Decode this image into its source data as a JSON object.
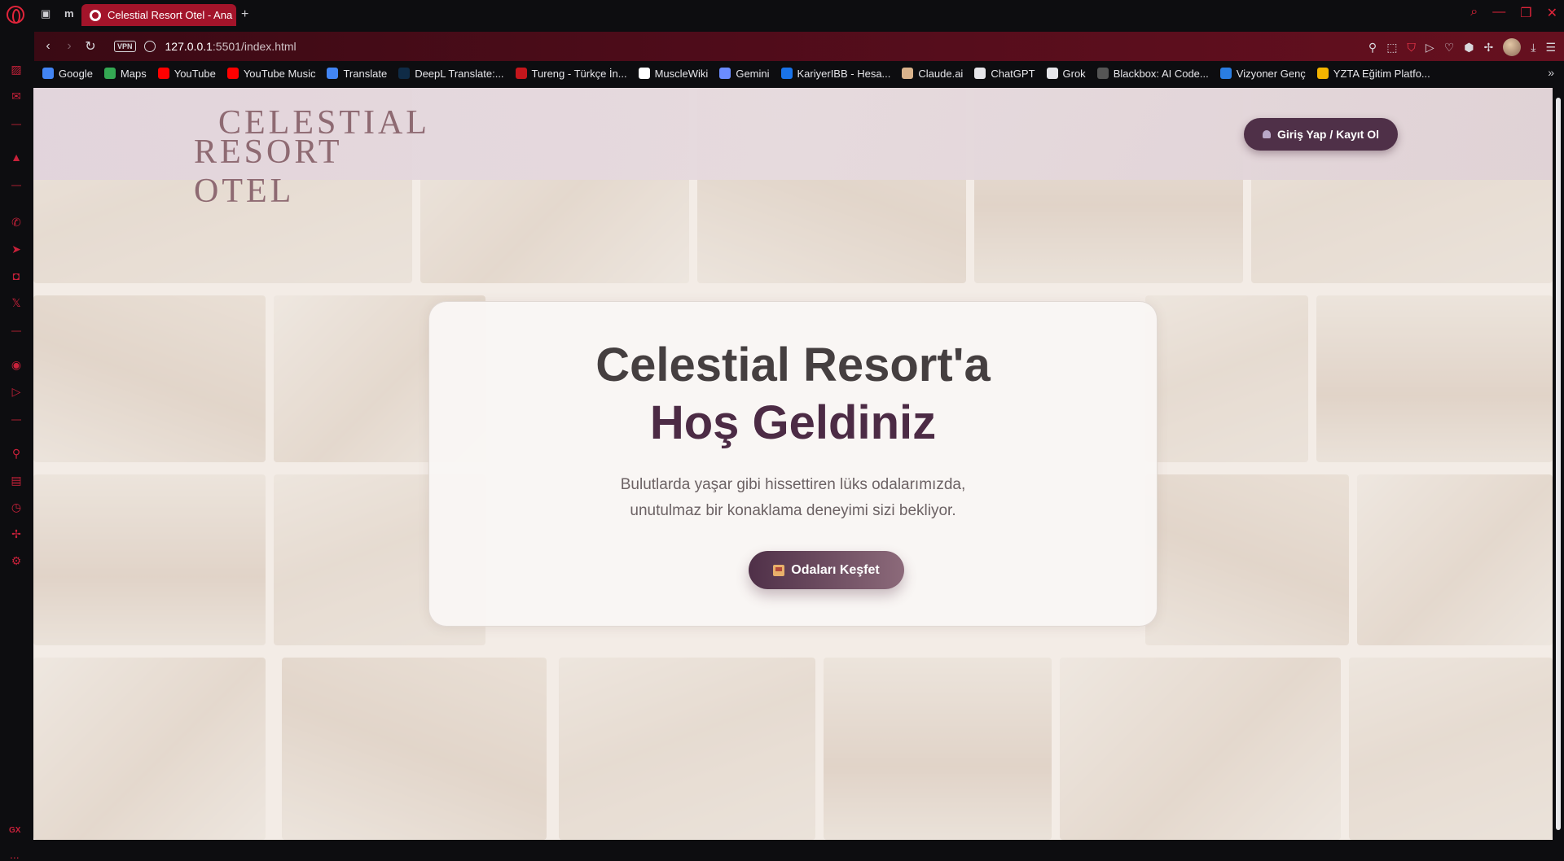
{
  "browser": {
    "tab_title": "Celestial Resort Otel - Ana",
    "new_tab_label": "+",
    "url_host": "127.0.0.1",
    "url_path": ":5501/index.html",
    "vpn_label": "VPN",
    "bookmarks": [
      {
        "label": "Google",
        "color": "#4285f4"
      },
      {
        "label": "Maps",
        "color": "#34a853"
      },
      {
        "label": "YouTube",
        "color": "#ff0000"
      },
      {
        "label": "YouTube Music",
        "color": "#ff0000"
      },
      {
        "label": "Translate",
        "color": "#4285f4"
      },
      {
        "label": "DeepL Translate:...",
        "color": "#0f2b46"
      },
      {
        "label": "Tureng - Türkçe İn...",
        "color": "#c4161c"
      },
      {
        "label": "MuscleWiki",
        "color": "#ffffff"
      },
      {
        "label": "Gemini",
        "color": "#6b8cff"
      },
      {
        "label": "KariyerIBB - Hesa...",
        "color": "#1a73e8"
      },
      {
        "label": "Claude.ai",
        "color": "#d9b38c"
      },
      {
        "label": "ChatGPT",
        "color": "#e6e6ea"
      },
      {
        "label": "Grok",
        "color": "#e6e6ea"
      },
      {
        "label": "Blackbox: AI Code...",
        "color": "#555555"
      },
      {
        "label": "Vizyoner Genç",
        "color": "#2a7de1"
      },
      {
        "label": "YZTA Eğitim Platfo...",
        "color": "#f4b400"
      }
    ]
  },
  "site": {
    "logo_line1": "CELESTIAL",
    "logo_line2": "RESORT OTEL",
    "login_button": "Giriş Yap / Kayıt Ol",
    "hero_title_1": "Celestial Resort'a",
    "hero_title_2": "Hoş Geldiniz",
    "hero_subtitle_1": "Bulutlarda yaşar gibi hissettiren lüks odalarımızda,",
    "hero_subtitle_2": "unutulmaz bir konaklama deneyimi sizi bekliyor.",
    "cta_button": "Odaları Keşfet",
    "brand_color": "#4f3048"
  },
  "sidebar": {
    "gx_label": "GX",
    "more_label": "..."
  }
}
